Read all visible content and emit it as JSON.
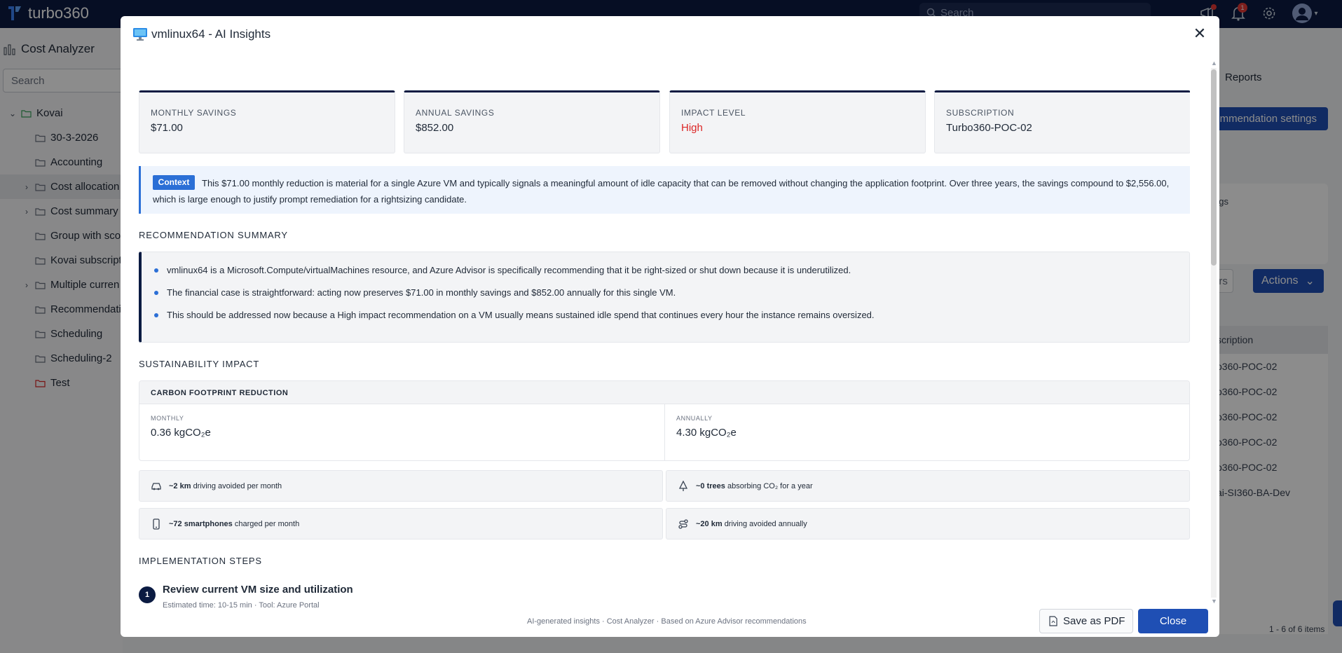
{
  "app": {
    "brand": "turbo360"
  },
  "topbar": {
    "search_placeholder": "Search",
    "notification_count": "1"
  },
  "sidebar": {
    "title": "Cost Analyzer",
    "search_placeholder": "Search",
    "items": [
      {
        "label": "Kovai",
        "expandable": true,
        "expanded": true,
        "folder_color": "#3aa35c",
        "level": 0
      },
      {
        "label": "30-3-2026",
        "level": 1
      },
      {
        "label": "Accounting",
        "level": 1
      },
      {
        "label": "Cost allocation",
        "level": 1,
        "expandable": true,
        "selected": true
      },
      {
        "label": "Cost summary",
        "level": 1,
        "expandable": true
      },
      {
        "label": "Group with scop",
        "level": 1
      },
      {
        "label": "Kovai subscript",
        "level": 1
      },
      {
        "label": "Multiple curren",
        "level": 1,
        "expandable": true
      },
      {
        "label": "Recommendation",
        "level": 1
      },
      {
        "label": "Scheduling",
        "level": 1
      },
      {
        "label": "Scheduling-2",
        "level": 1
      },
      {
        "label": "Test",
        "level": 1,
        "folder_color": "#dc2626"
      }
    ]
  },
  "background": {
    "reports_tab": "Reports",
    "recommendation_settings_button": "mmendation settings",
    "card_text": "ngs",
    "filters_button": "ers",
    "actions_button": "Actions",
    "table_header": "scription",
    "rows": [
      "o360-POC-02",
      "o360-POC-02",
      "o360-POC-02",
      "o360-POC-02",
      "o360-POC-02",
      "ai-SI360-BA-Dev"
    ],
    "pagination": "1 - 6 of 6 items"
  },
  "modal": {
    "title": "vmlinux64 - AI Insights",
    "stats": [
      {
        "label": "MONTHLY SAVINGS",
        "value": "$71.00"
      },
      {
        "label": "ANNUAL SAVINGS",
        "value": "$852.00"
      },
      {
        "label": "IMPACT LEVEL",
        "value": "High",
        "color": "#dc2626"
      },
      {
        "label": "SUBSCRIPTION",
        "value": "Turbo360-POC-02"
      }
    ],
    "context": {
      "badge": "Context",
      "text": "This $71.00 monthly reduction is material for a single Azure VM and typically signals a meaningful amount of idle capacity that can be removed without changing the application footprint. Over three years, the savings compound to $2,556.00, which is large enough to justify prompt remediation for a rightsizing candidate."
    },
    "summary": {
      "title": "RECOMMENDATION SUMMARY",
      "items": [
        "vmlinux64 is a Microsoft.Compute/virtualMachines resource, and Azure Advisor is specifically recommending that it be right-sized or shut down because it is underutilized.",
        "The financial case is straightforward: acting now preserves $71.00 in monthly savings and $852.00 annually for this single VM.",
        "This should be addressed now because a High impact recommendation on a VM usually means sustained idle spend that continues every hour the instance remains oversized."
      ]
    },
    "sustainability": {
      "title": "SUSTAINABILITY IMPACT",
      "carbon_title": "CARBON FOOTPRINT REDUCTION",
      "monthly_label": "MONTHLY",
      "monthly_value": "0.36 kgCO₂e",
      "annually_label": "ANNUALLY",
      "annually_value": "4.30 kgCO₂e",
      "equivalents": [
        {
          "icon": "car-icon",
          "bold": "~2 km",
          "text": "driving avoided per month"
        },
        {
          "icon": "tree-icon",
          "bold": "~0 trees",
          "text": "absorbing CO₂ for a year"
        },
        {
          "icon": "smartphone-icon",
          "bold": "~72 smartphones",
          "text": "charged per month"
        },
        {
          "icon": "route-icon",
          "bold": "~20 km",
          "text": "driving avoided annually"
        }
      ]
    },
    "steps": {
      "title": "IMPLEMENTATION STEPS",
      "items": [
        {
          "number": "1",
          "title": "Review current VM size and utilization",
          "meta": "Estimated time: 10-15 min · Tool: Azure Portal"
        }
      ]
    },
    "footer": {
      "note": "AI-generated insights · Cost Analyzer · Based on Azure Advisor recommendations",
      "save_pdf": "Save as PDF",
      "close": "Close"
    }
  },
  "colors": {
    "navy": "#0b1b42",
    "primary": "#1f4fb4",
    "accent": "#2b6fd6",
    "danger": "#dc2626"
  }
}
